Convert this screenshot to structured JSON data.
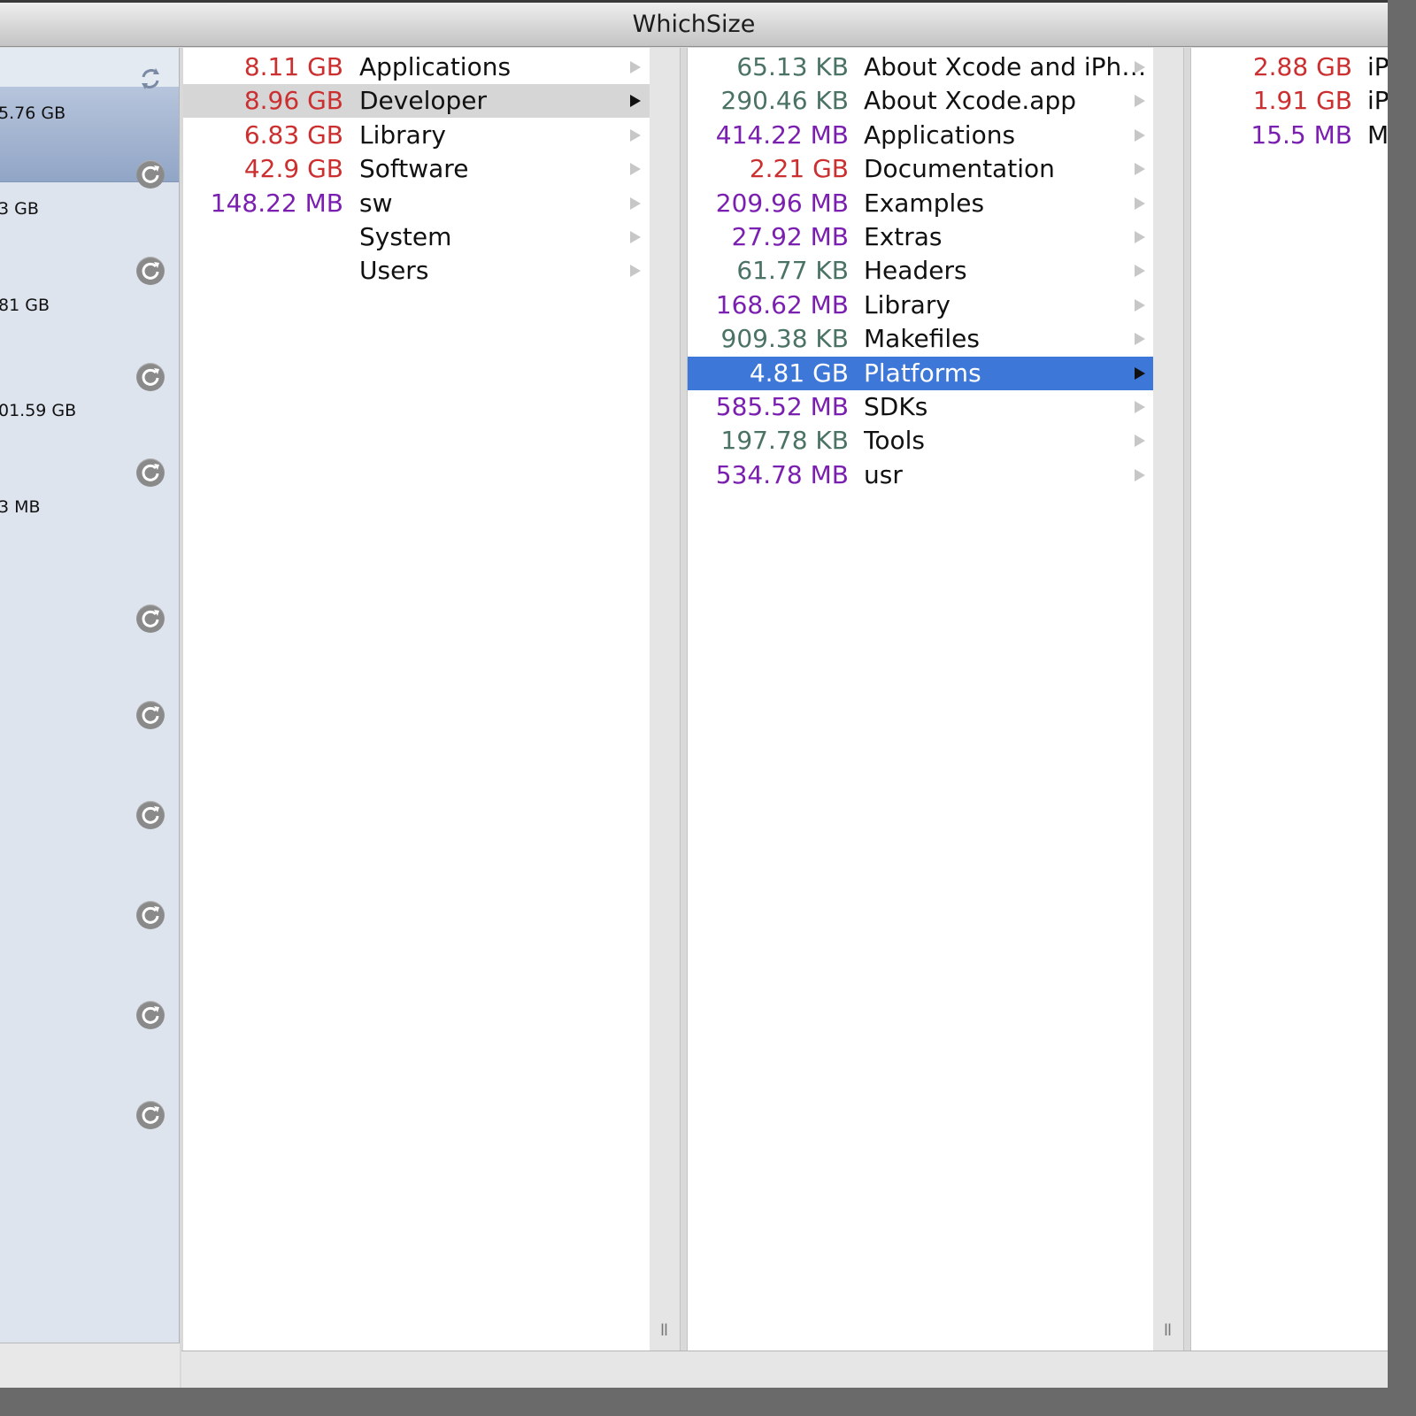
{
  "window": {
    "title": "WhichSize"
  },
  "sidebar": {
    "items": [
      {
        "size": "5.76 GB",
        "selected": true
      },
      {
        "size": "3 GB"
      },
      {
        "size": "81 GB"
      },
      {
        "size": "01.59 GB"
      },
      {
        "size": "3 MB"
      },
      {
        "size": ""
      },
      {
        "size": ""
      },
      {
        "size": ""
      },
      {
        "size": ""
      },
      {
        "size": ""
      },
      {
        "size": ""
      }
    ],
    "refresh_icon": "refresh-icon"
  },
  "columns": [
    {
      "rows": [
        {
          "size": "8.11 GB",
          "name": "Applications",
          "color": "red"
        },
        {
          "size": "8.96 GB",
          "name": "Developer",
          "color": "red",
          "selected": "gray"
        },
        {
          "size": "6.83 GB",
          "name": "Library",
          "color": "red"
        },
        {
          "size": "42.9 GB",
          "name": "Software",
          "color": "red"
        },
        {
          "size": "148.22 MB",
          "name": "sw",
          "color": "purple"
        },
        {
          "size": "",
          "name": "System",
          "color": "red"
        },
        {
          "size": "",
          "name": "Users",
          "color": "red"
        }
      ]
    },
    {
      "rows": [
        {
          "size": "65.13 KB",
          "name": "About Xcode and iPh…",
          "color": "green"
        },
        {
          "size": "290.46 KB",
          "name": "About Xcode.app",
          "color": "green"
        },
        {
          "size": "414.22 MB",
          "name": "Applications",
          "color": "purple"
        },
        {
          "size": "2.21 GB",
          "name": "Documentation",
          "color": "red"
        },
        {
          "size": "209.96 MB",
          "name": "Examples",
          "color": "purple"
        },
        {
          "size": "27.92 MB",
          "name": "Extras",
          "color": "purple"
        },
        {
          "size": "61.77 KB",
          "name": "Headers",
          "color": "green"
        },
        {
          "size": "168.62 MB",
          "name": "Library",
          "color": "purple"
        },
        {
          "size": "909.38 KB",
          "name": "Makefiles",
          "color": "green"
        },
        {
          "size": "4.81 GB",
          "name": "Platforms",
          "color": "red",
          "selected": "blue"
        },
        {
          "size": "585.52 MB",
          "name": "SDKs",
          "color": "purple"
        },
        {
          "size": "197.78 KB",
          "name": "Tools",
          "color": "green"
        },
        {
          "size": "534.78 MB",
          "name": "usr",
          "color": "purple"
        }
      ]
    },
    {
      "rows": [
        {
          "size": "2.88 GB",
          "name": "iP",
          "color": "red"
        },
        {
          "size": "1.91 GB",
          "name": "iP",
          "color": "red"
        },
        {
          "size": "15.5 MB",
          "name": "M",
          "color": "purple"
        }
      ]
    }
  ],
  "colors": {
    "red": "#cc2f2f",
    "purple": "#7a1fb0",
    "green": "#4b7363",
    "selection_blue": "#3d77d8",
    "selection_gray": "#d6d6d6"
  },
  "column_resize_glyph": "ll"
}
